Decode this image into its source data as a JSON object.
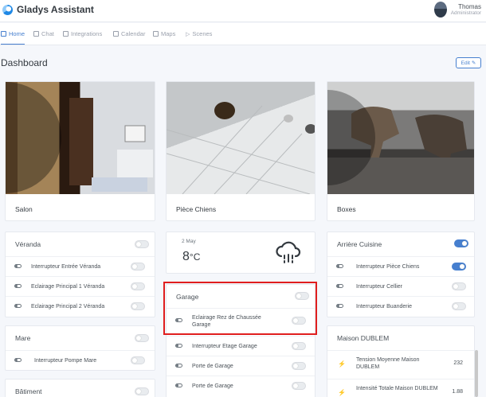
{
  "app": {
    "title": "Gladys Assistant"
  },
  "user": {
    "name": "Thomas",
    "role": "Administrator"
  },
  "nav": {
    "home": "Home",
    "chat": "Chat",
    "integrations": "Integrations",
    "calendar": "Calendar",
    "maps": "Maps",
    "scenes": "Scenes"
  },
  "dashboard": {
    "title": "Dashboard",
    "edit_label": "Edit"
  },
  "cameras": [
    {
      "label": "Salon"
    },
    {
      "label": "Pièce Chiens"
    },
    {
      "label": "Boxes"
    }
  ],
  "veranda": {
    "title": "Véranda",
    "on": false,
    "rows": [
      {
        "label": "Interrupteur Entrée Véranda",
        "on": false
      },
      {
        "label": "Eclairage Principal 1 Véranda",
        "on": false
      },
      {
        "label": "Eclairage Principal 2 Véranda",
        "on": false
      }
    ]
  },
  "mare": {
    "title": "Mare",
    "on": false,
    "rows": [
      {
        "label": "Interrupteur Pompe Mare",
        "on": false
      }
    ]
  },
  "batiment": {
    "title": "Bâtiment",
    "on": false
  },
  "weather": {
    "date": "2 May",
    "temperature": "8",
    "unit": "°C",
    "icon": "rain-cloud-icon"
  },
  "garage": {
    "title": "Garage",
    "on": false,
    "rows": [
      {
        "label": "Eclairage Rez de Chaussée Garage",
        "on": false
      },
      {
        "label": "Interrupteur Etage Garage",
        "on": false
      },
      {
        "label": "Porte de Garage",
        "on": false
      },
      {
        "label": "Porte de Garage",
        "on": false
      }
    ]
  },
  "arriere_cuisine": {
    "title": "Arrière Cuisine",
    "on": true,
    "rows": [
      {
        "label": "Interrupteur Pièce Chiens",
        "on": true
      },
      {
        "label": "Interrupteur Cellier",
        "on": false
      },
      {
        "label": "Interrupteur Buanderie",
        "on": false
      }
    ]
  },
  "maison": {
    "title": "Maison DUBLEM",
    "rows": [
      {
        "label": "Tension Moyenne Maison DUBLEM",
        "value": "232"
      },
      {
        "label": "Intensité Totale Maison DUBLEM",
        "value": "1.88"
      }
    ]
  },
  "colors": {
    "accent": "#467fcf",
    "highlight": "#e01e1e"
  }
}
